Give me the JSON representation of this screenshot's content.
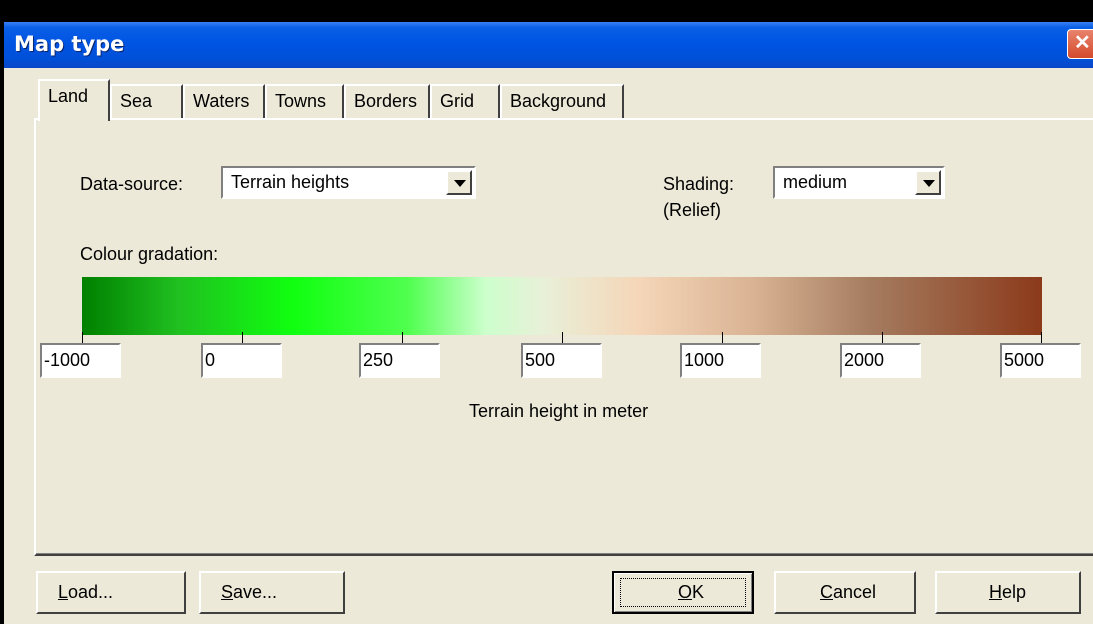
{
  "window": {
    "title": "Map type",
    "close_glyph": "✕"
  },
  "tabs": [
    {
      "label": "Land",
      "active": true
    },
    {
      "label": "Sea"
    },
    {
      "label": "Waters"
    },
    {
      "label": "Towns"
    },
    {
      "label": "Borders"
    },
    {
      "label": "Grid"
    },
    {
      "label": "Background"
    }
  ],
  "land": {
    "data_source_label": "Data-source:",
    "data_source_value": "Terrain heights",
    "shading_label": "Shading:",
    "shading_sublabel": "(Relief)",
    "shading_value": "medium",
    "colour_gradation_label": "Colour gradation:",
    "gradient_colors": [
      "#008000",
      "#10ff10",
      "#ccffcc",
      "#f5d6b8",
      "#a57c60",
      "#8b3a1a"
    ],
    "thresholds": [
      "-1000",
      "0",
      "250",
      "500",
      "1000",
      "2000",
      "5000"
    ],
    "axis_caption": "Terrain height in meter"
  },
  "buttons": {
    "load": {
      "mnemonic": "L",
      "rest": "oad..."
    },
    "save": {
      "mnemonic": "S",
      "rest": "ave..."
    },
    "ok": {
      "mnemonic": "O",
      "rest": "K"
    },
    "cancel": {
      "mnemonic": "C",
      "rest": "ancel"
    },
    "help": {
      "mnemonic": "H",
      "rest": "elp"
    }
  }
}
